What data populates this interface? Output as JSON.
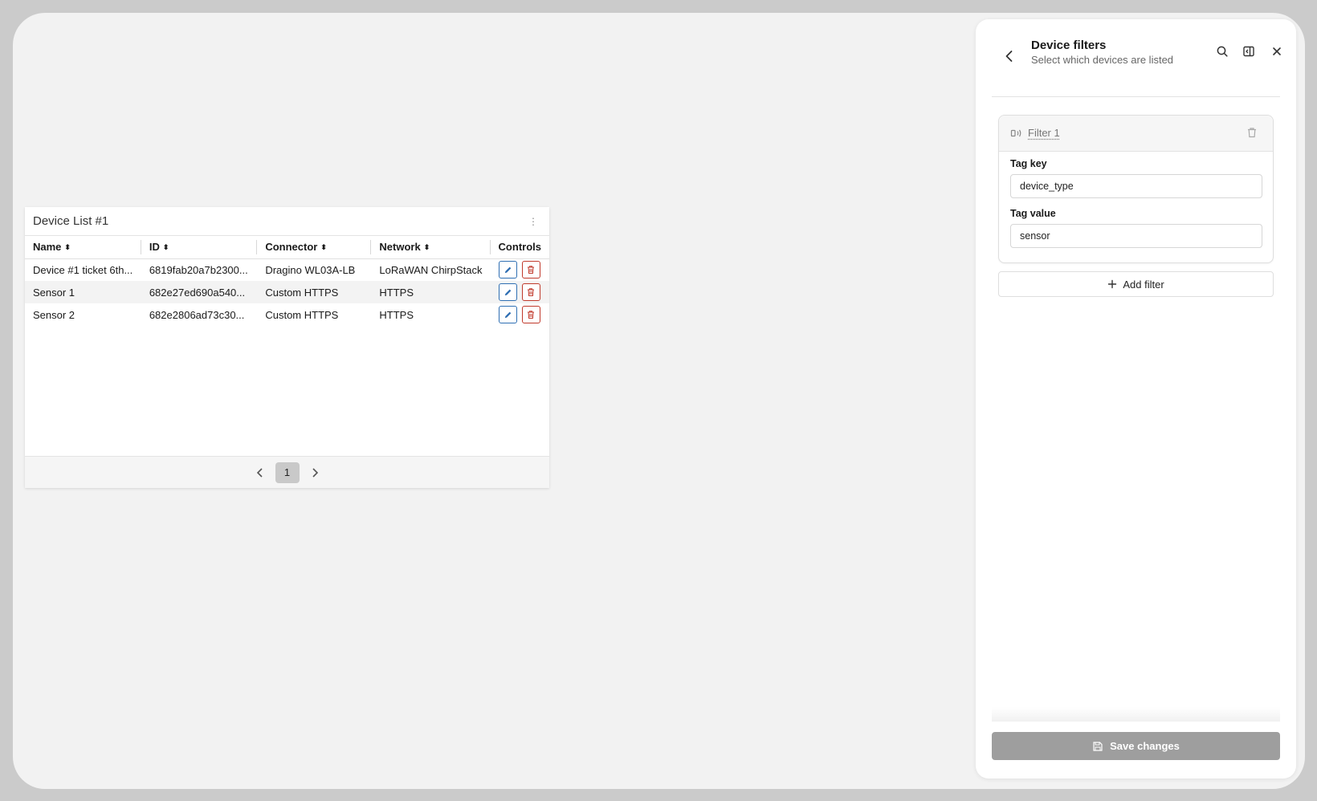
{
  "device_list": {
    "title": "Device List #1",
    "columns": [
      "Name",
      "ID",
      "Connector",
      "Network",
      "Controls"
    ],
    "rows": [
      {
        "name": "Device #1 ticket 6th...",
        "id": "6819fab20a7b2300...",
        "connector": "Dragino WL03A-LB",
        "network": "LoRaWAN ChirpStack"
      },
      {
        "name": "Sensor 1",
        "id": "682e27ed690a540...",
        "connector": "Custom HTTPS",
        "network": "HTTPS"
      },
      {
        "name": "Sensor 2",
        "id": "682e2806ad73c30...",
        "connector": "Custom HTTPS",
        "network": "HTTPS"
      }
    ],
    "pagination": {
      "current_page": "1"
    },
    "icons": {
      "menu": "kebab-icon",
      "sort": "sort-icon",
      "edit": "pencil-icon",
      "delete": "trash-icon",
      "prev": "chevron-left-icon",
      "next": "chevron-right-icon"
    }
  },
  "panel": {
    "title": "Device filters",
    "subtitle": "Select which devices are listed",
    "icons": {
      "back": "chevron-left-icon",
      "search": "search-icon",
      "dock": "panel-dock-icon",
      "close": "close-icon"
    },
    "filter": {
      "name": "Filter 1",
      "tag_key_label": "Tag key",
      "tag_key_value": "device_type",
      "tag_value_label": "Tag value",
      "tag_value_value": "sensor"
    },
    "add_filter_label": "Add filter",
    "save_label": "Save changes"
  },
  "colors": {
    "edit_accent": "#2f6fb3",
    "delete_accent": "#c0392b",
    "save_button": "#9e9e9e",
    "background": "#f2f2f2"
  }
}
